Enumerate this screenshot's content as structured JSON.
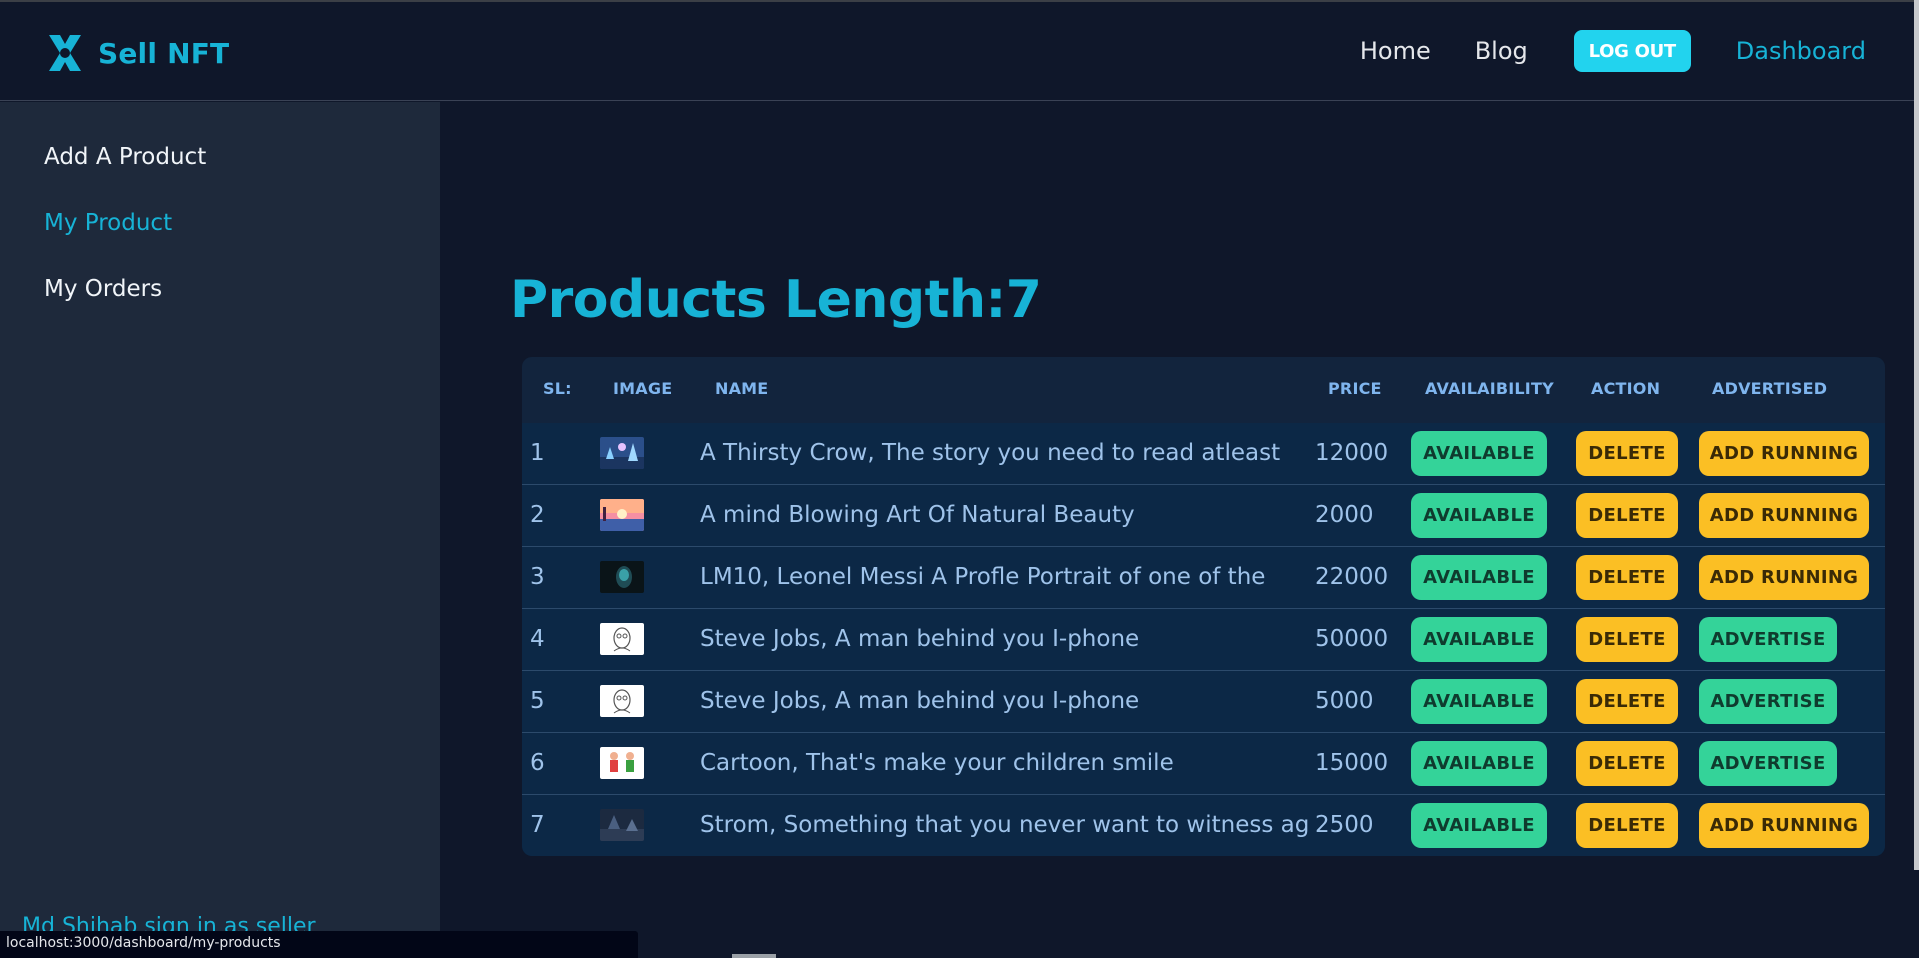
{
  "brand": {
    "name": "Sell NFT",
    "icon": "x-logo-icon",
    "color": "#17b3d6"
  },
  "nav": {
    "home": "Home",
    "blog": "Blog",
    "logout": "LOG OUT",
    "dashboard": "Dashboard"
  },
  "sidebar": {
    "items": [
      {
        "label": "Add A Product",
        "active": false
      },
      {
        "label": "My Product",
        "active": true
      },
      {
        "label": "My Orders",
        "active": false
      }
    ],
    "footer": "Md Shihab sign in as seller"
  },
  "status_url": "localhost:3000/dashboard/my-products",
  "main": {
    "title": "Products Length:7",
    "table": {
      "headers": [
        "SL:",
        "IMAGE",
        "NAME",
        "PRICE",
        "AVAILAIBILITY",
        "ACTION",
        "ADVERTISED"
      ],
      "rows": [
        {
          "sl": "1",
          "image": "forest-landscape",
          "name": "A Thirsty Crow, The story you need to read atleast",
          "price": "12000",
          "availability": "AVAILABLE",
          "action": "DELETE",
          "advertised": "ADD RUNNING"
        },
        {
          "sl": "2",
          "image": "sunset-beach",
          "name": "A mind Blowing Art Of Natural Beauty",
          "price": "2000",
          "availability": "AVAILABLE",
          "action": "DELETE",
          "advertised": "ADD RUNNING"
        },
        {
          "sl": "3",
          "image": "dark-portrait",
          "name": "LM10, Leonel Messi A Profle Portrait of one of the",
          "price": "22000",
          "availability": "AVAILABLE",
          "action": "DELETE",
          "advertised": "ADD RUNNING"
        },
        {
          "sl": "4",
          "image": "sketch-portrait",
          "name": "Steve Jobs, A man behind you I-phone",
          "price": "50000",
          "availability": "AVAILABLE",
          "action": "DELETE",
          "advertised": "ADVERTISE"
        },
        {
          "sl": "5",
          "image": "sketch-portrait",
          "name": "Steve Jobs, A man behind you I-phone",
          "price": "5000",
          "availability": "AVAILABLE",
          "action": "DELETE",
          "advertised": "ADVERTISE"
        },
        {
          "sl": "6",
          "image": "cartoon-kids",
          "name": "Cartoon, That's make your children smile",
          "price": "15000",
          "availability": "AVAILABLE",
          "action": "DELETE",
          "advertised": "ADVERTISE"
        },
        {
          "sl": "7",
          "image": "storm-scene",
          "name": "Strom, Something that you never want to witness ag",
          "price": "2500",
          "availability": "AVAILABLE",
          "action": "DELETE",
          "advertised": "ADD RUNNING"
        }
      ]
    }
  },
  "colors": {
    "accent": "#17b3d6",
    "available": "#34d399",
    "delete": "#fbbf24",
    "ad_running": "#fbbf24",
    "advertise": "#34d399"
  }
}
